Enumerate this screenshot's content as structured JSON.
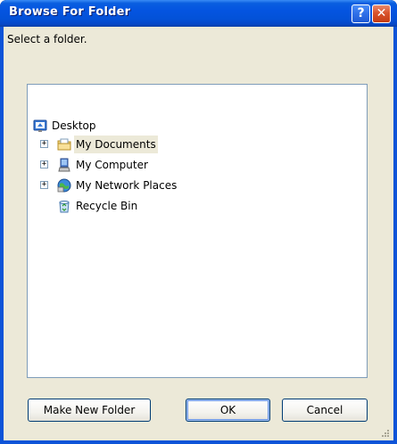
{
  "window": {
    "title": "Browse For Folder",
    "help_glyph": "?",
    "close_glyph": "✕"
  },
  "dialog": {
    "prompt": "Select a folder."
  },
  "tree": {
    "root": {
      "label": "Desktop",
      "icon": "desktop-icon"
    },
    "items": [
      {
        "label": "My Documents",
        "icon": "my-documents-icon",
        "expander": "+",
        "selected": true
      },
      {
        "label": "My Computer",
        "icon": "my-computer-icon",
        "expander": "+"
      },
      {
        "label": "My Network Places",
        "icon": "network-places-icon",
        "expander": "+"
      },
      {
        "label": "Recycle Bin",
        "icon": "recycle-bin-icon"
      }
    ]
  },
  "buttons": {
    "make_new_folder": "Make New Folder",
    "ok": "OK",
    "cancel": "Cancel"
  },
  "colors": {
    "title_bar": "#0454e0",
    "dialog_bg": "#ece9d8",
    "close_button": "#d9532c",
    "selection": "#ece9d8"
  }
}
